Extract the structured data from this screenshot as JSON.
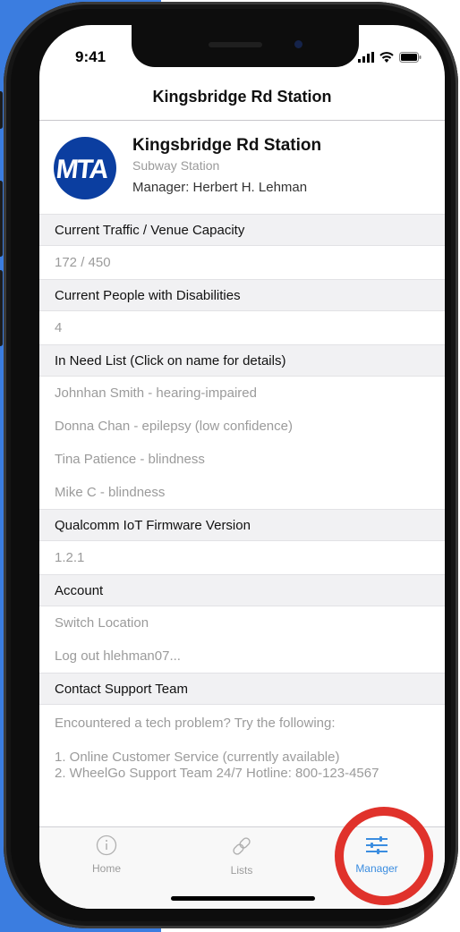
{
  "status": {
    "time": "9:41"
  },
  "nav": {
    "title": "Kingsbridge Rd Station"
  },
  "profile": {
    "logo_text": "MTA",
    "name": "Kingsbridge Rd Station",
    "type": "Subway Station",
    "manager": "Manager: Herbert H. Lehman"
  },
  "sections": {
    "traffic": {
      "header": "Current Traffic / Venue Capacity",
      "value": "172 / 450"
    },
    "disabilities": {
      "header": "Current People with Disabilities",
      "value": "4"
    },
    "in_need": {
      "header": "In Need List (Click on name for details)",
      "items": [
        "Johnhan Smith - hearing-impaired",
        "Donna Chan - epilepsy (low confidence)",
        "Tina Patience - blindness",
        "Mike C - blindness"
      ]
    },
    "firmware": {
      "header": "Qualcomm IoT Firmware Version",
      "value": "1.2.1"
    },
    "account": {
      "header": "Account",
      "switch": "Switch Location",
      "logout": "Log out hlehman07..."
    },
    "support": {
      "header": "Contact Support Team",
      "intro": "Encountered a tech problem? Try the following:",
      "option1": "1. Online Customer Service (currently available)",
      "option2": "2. WheelGo Support Team 24/7 Hotline: 800-123-4567"
    }
  },
  "tabbar": {
    "home": "Home",
    "lists": "Lists",
    "manager": "Manager",
    "active": "manager"
  },
  "colors": {
    "background": "#3b7de0",
    "active_tab": "#3b8de0",
    "inactive_tab": "#9b9b9b",
    "mta_blue": "#0b3ea0",
    "highlight_circle": "#e0322b"
  }
}
